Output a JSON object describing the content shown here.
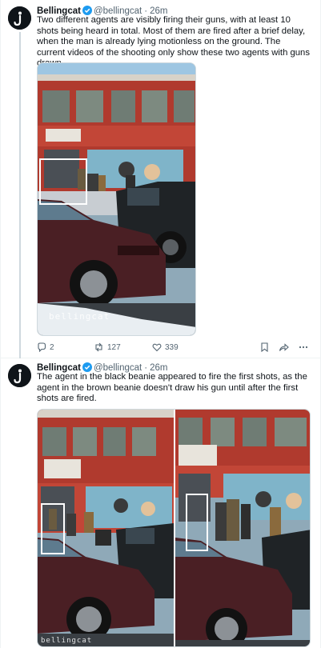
{
  "posts": [
    {
      "author": "Bellingcat",
      "handle": "@bellingcat",
      "separator": "·",
      "time": "26m",
      "text": "Two different agents are visibly firing their guns, with at least 10 shots being heard in total. Most of them are fired after a brief delay, when the man is already lying motionless on the ground. The current videos of the shooting only show these two agents with guns drawn.",
      "watermark": "bellingcat",
      "actions": {
        "replies": "2",
        "reposts": "127",
        "likes": "339"
      }
    },
    {
      "author": "Bellingcat",
      "handle": "@bellingcat",
      "separator": "·",
      "time": "26m",
      "text": "The agent in the black beanie appeared to fire the first shots, as the agent in the brown beanie doesn't draw his gun until after the first shots are fired.",
      "watermark": "bellingcat"
    }
  ],
  "colors": {
    "accent": "#1d9bf0",
    "secondary_text": "#536471",
    "divider": "#eff3f4",
    "building_red": "#b03a2e"
  },
  "icons": [
    "avatar-logo",
    "verified-badge-icon",
    "reply-icon",
    "repost-icon",
    "like-icon",
    "bookmark-icon",
    "share-icon",
    "more-icon"
  ]
}
